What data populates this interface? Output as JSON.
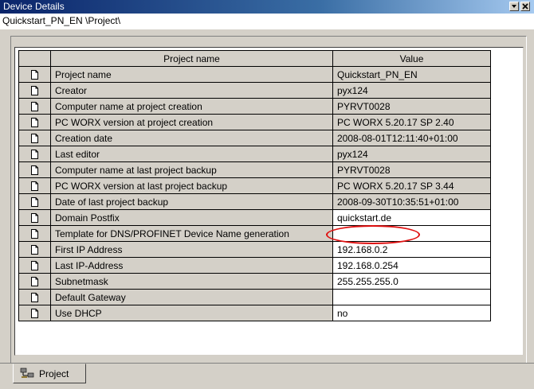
{
  "window": {
    "title": "Device Details"
  },
  "path": "Quickstart_PN_EN \\Project\\",
  "grid": {
    "columns": [
      "Project name",
      "Value"
    ],
    "rows": [
      {
        "name": "Project name",
        "value": "Quickstart_PN_EN",
        "editable": false
      },
      {
        "name": "Creator",
        "value": "pyx124",
        "editable": false
      },
      {
        "name": "Computer name at project creation",
        "value": "PYRVT0028",
        "editable": false
      },
      {
        "name": "PC WORX version at project creation",
        "value": "PC WORX 5.20.17 SP 2.40",
        "editable": false
      },
      {
        "name": "Creation date",
        "value": "2008-08-01T12:11:40+01:00",
        "editable": false
      },
      {
        "name": "Last editor",
        "value": "pyx124",
        "editable": false
      },
      {
        "name": "Computer name at last project backup",
        "value": "PYRVT0028",
        "editable": false
      },
      {
        "name": "PC WORX version at last project backup",
        "value": "PC WORX 5.20.17 SP 3.44",
        "editable": false
      },
      {
        "name": "Date of last project backup",
        "value": "2008-09-30T10:35:51+01:00",
        "editable": false
      },
      {
        "name": "Domain Postfix",
        "value": "quickstart.de",
        "editable": true
      },
      {
        "name": "Template for DNS/PROFINET Device Name generation",
        "value": "",
        "editable": true
      },
      {
        "name": "First IP Address",
        "value": "192.168.0.2",
        "editable": true
      },
      {
        "name": "Last IP-Address",
        "value": "192.168.0.254",
        "editable": true
      },
      {
        "name": "Subnetmask",
        "value": "255.255.255.0",
        "editable": true
      },
      {
        "name": "Default Gateway",
        "value": "",
        "editable": true
      },
      {
        "name": "Use DHCP",
        "value": "no",
        "editable": true
      }
    ]
  },
  "tabs": [
    {
      "label": "Project",
      "icon": "project-tree-icon"
    }
  ],
  "highlight": {
    "target": "Domain Postfix value",
    "color": "#e01010"
  }
}
